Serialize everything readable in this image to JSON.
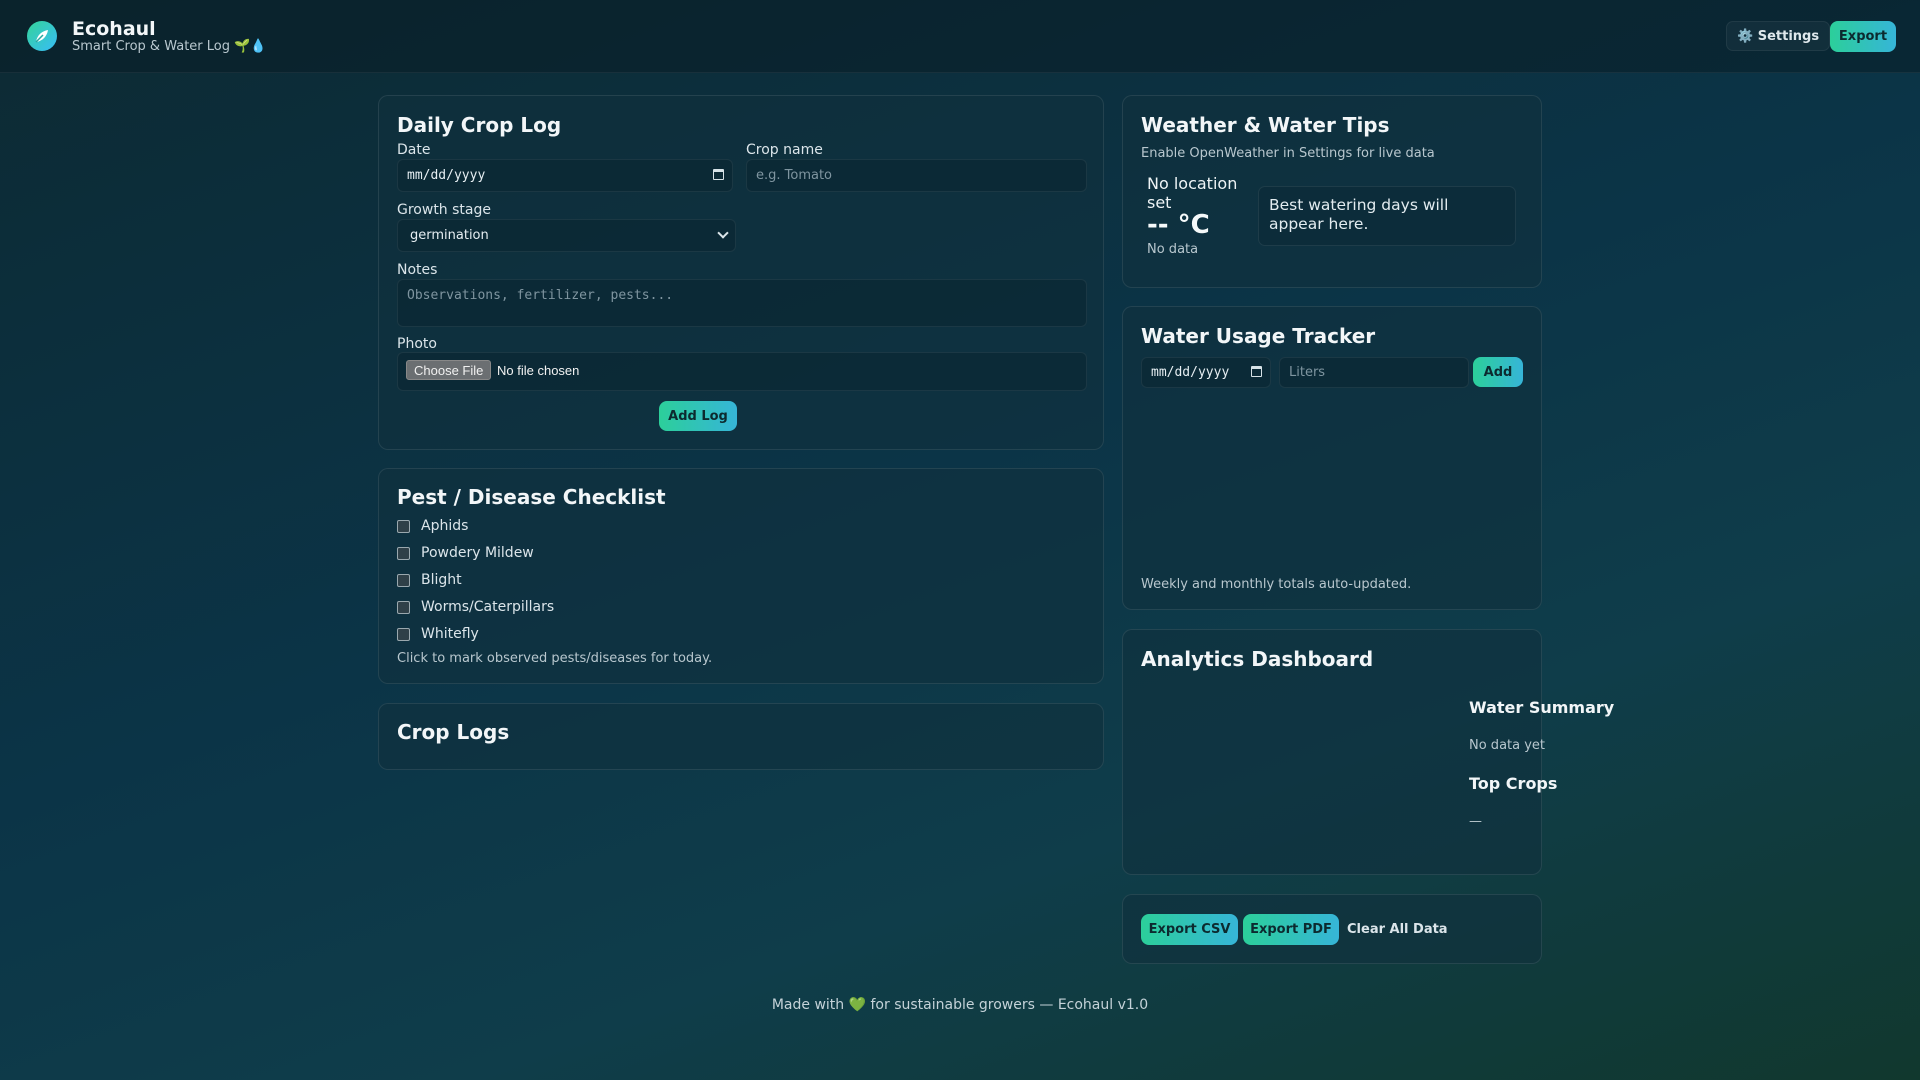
{
  "header": {
    "app_name": "Ecohaul",
    "tagline": "Smart Crop & Water Log 🌱💧",
    "settings_label": "⚙️ Settings",
    "export_label": "Export"
  },
  "crop_log": {
    "title": "Daily Crop Log",
    "date_label": "Date",
    "date_value": "mm/dd/yyyy",
    "crop_name_label": "Crop name",
    "crop_name_placeholder": "e.g. Tomato",
    "growth_stage_label": "Growth stage",
    "growth_stage_value": "germination",
    "notes_label": "Notes",
    "notes_placeholder": "Observations, fertilizer, pests...",
    "photo_label": "Photo",
    "choose_file_label": "Choose File",
    "no_file_label": "No file chosen",
    "add_log_label": "Add Log"
  },
  "checklist": {
    "title": "Pest / Disease Checklist",
    "items": [
      "Aphids",
      "Powdery Mildew",
      "Blight",
      "Worms/Caterpillars",
      "Whitefly"
    ],
    "hint": "Click to mark observed pests/diseases for today."
  },
  "crop_logs": {
    "title": "Crop Logs"
  },
  "weather": {
    "title": "Weather & Water Tips",
    "subtitle": "Enable OpenWeather in Settings for live data",
    "location": "No location set",
    "temperature": "-- °C",
    "status": "No data",
    "tip": "Best watering days will appear here."
  },
  "water": {
    "title": "Water Usage Tracker",
    "date_value": "mm/dd/yyyy",
    "liters_placeholder": "Liters",
    "add_label": "Add",
    "footnote": "Weekly and monthly totals auto-updated."
  },
  "analytics": {
    "title": "Analytics Dashboard",
    "water_summary_title": "Water Summary",
    "water_summary_value": "No data yet",
    "top_crops_title": "Top Crops",
    "top_crops_value": "—"
  },
  "actions": {
    "export_csv": "Export CSV",
    "export_pdf": "Export PDF",
    "clear_all": "Clear All Data"
  },
  "footer": {
    "made_with": "Made with",
    "heart": "💚",
    "rest": "for sustainable growers — Ecohaul v1.0"
  },
  "colors": {
    "accent_start": "#2ccf9a",
    "accent_end": "#36b5d8"
  }
}
